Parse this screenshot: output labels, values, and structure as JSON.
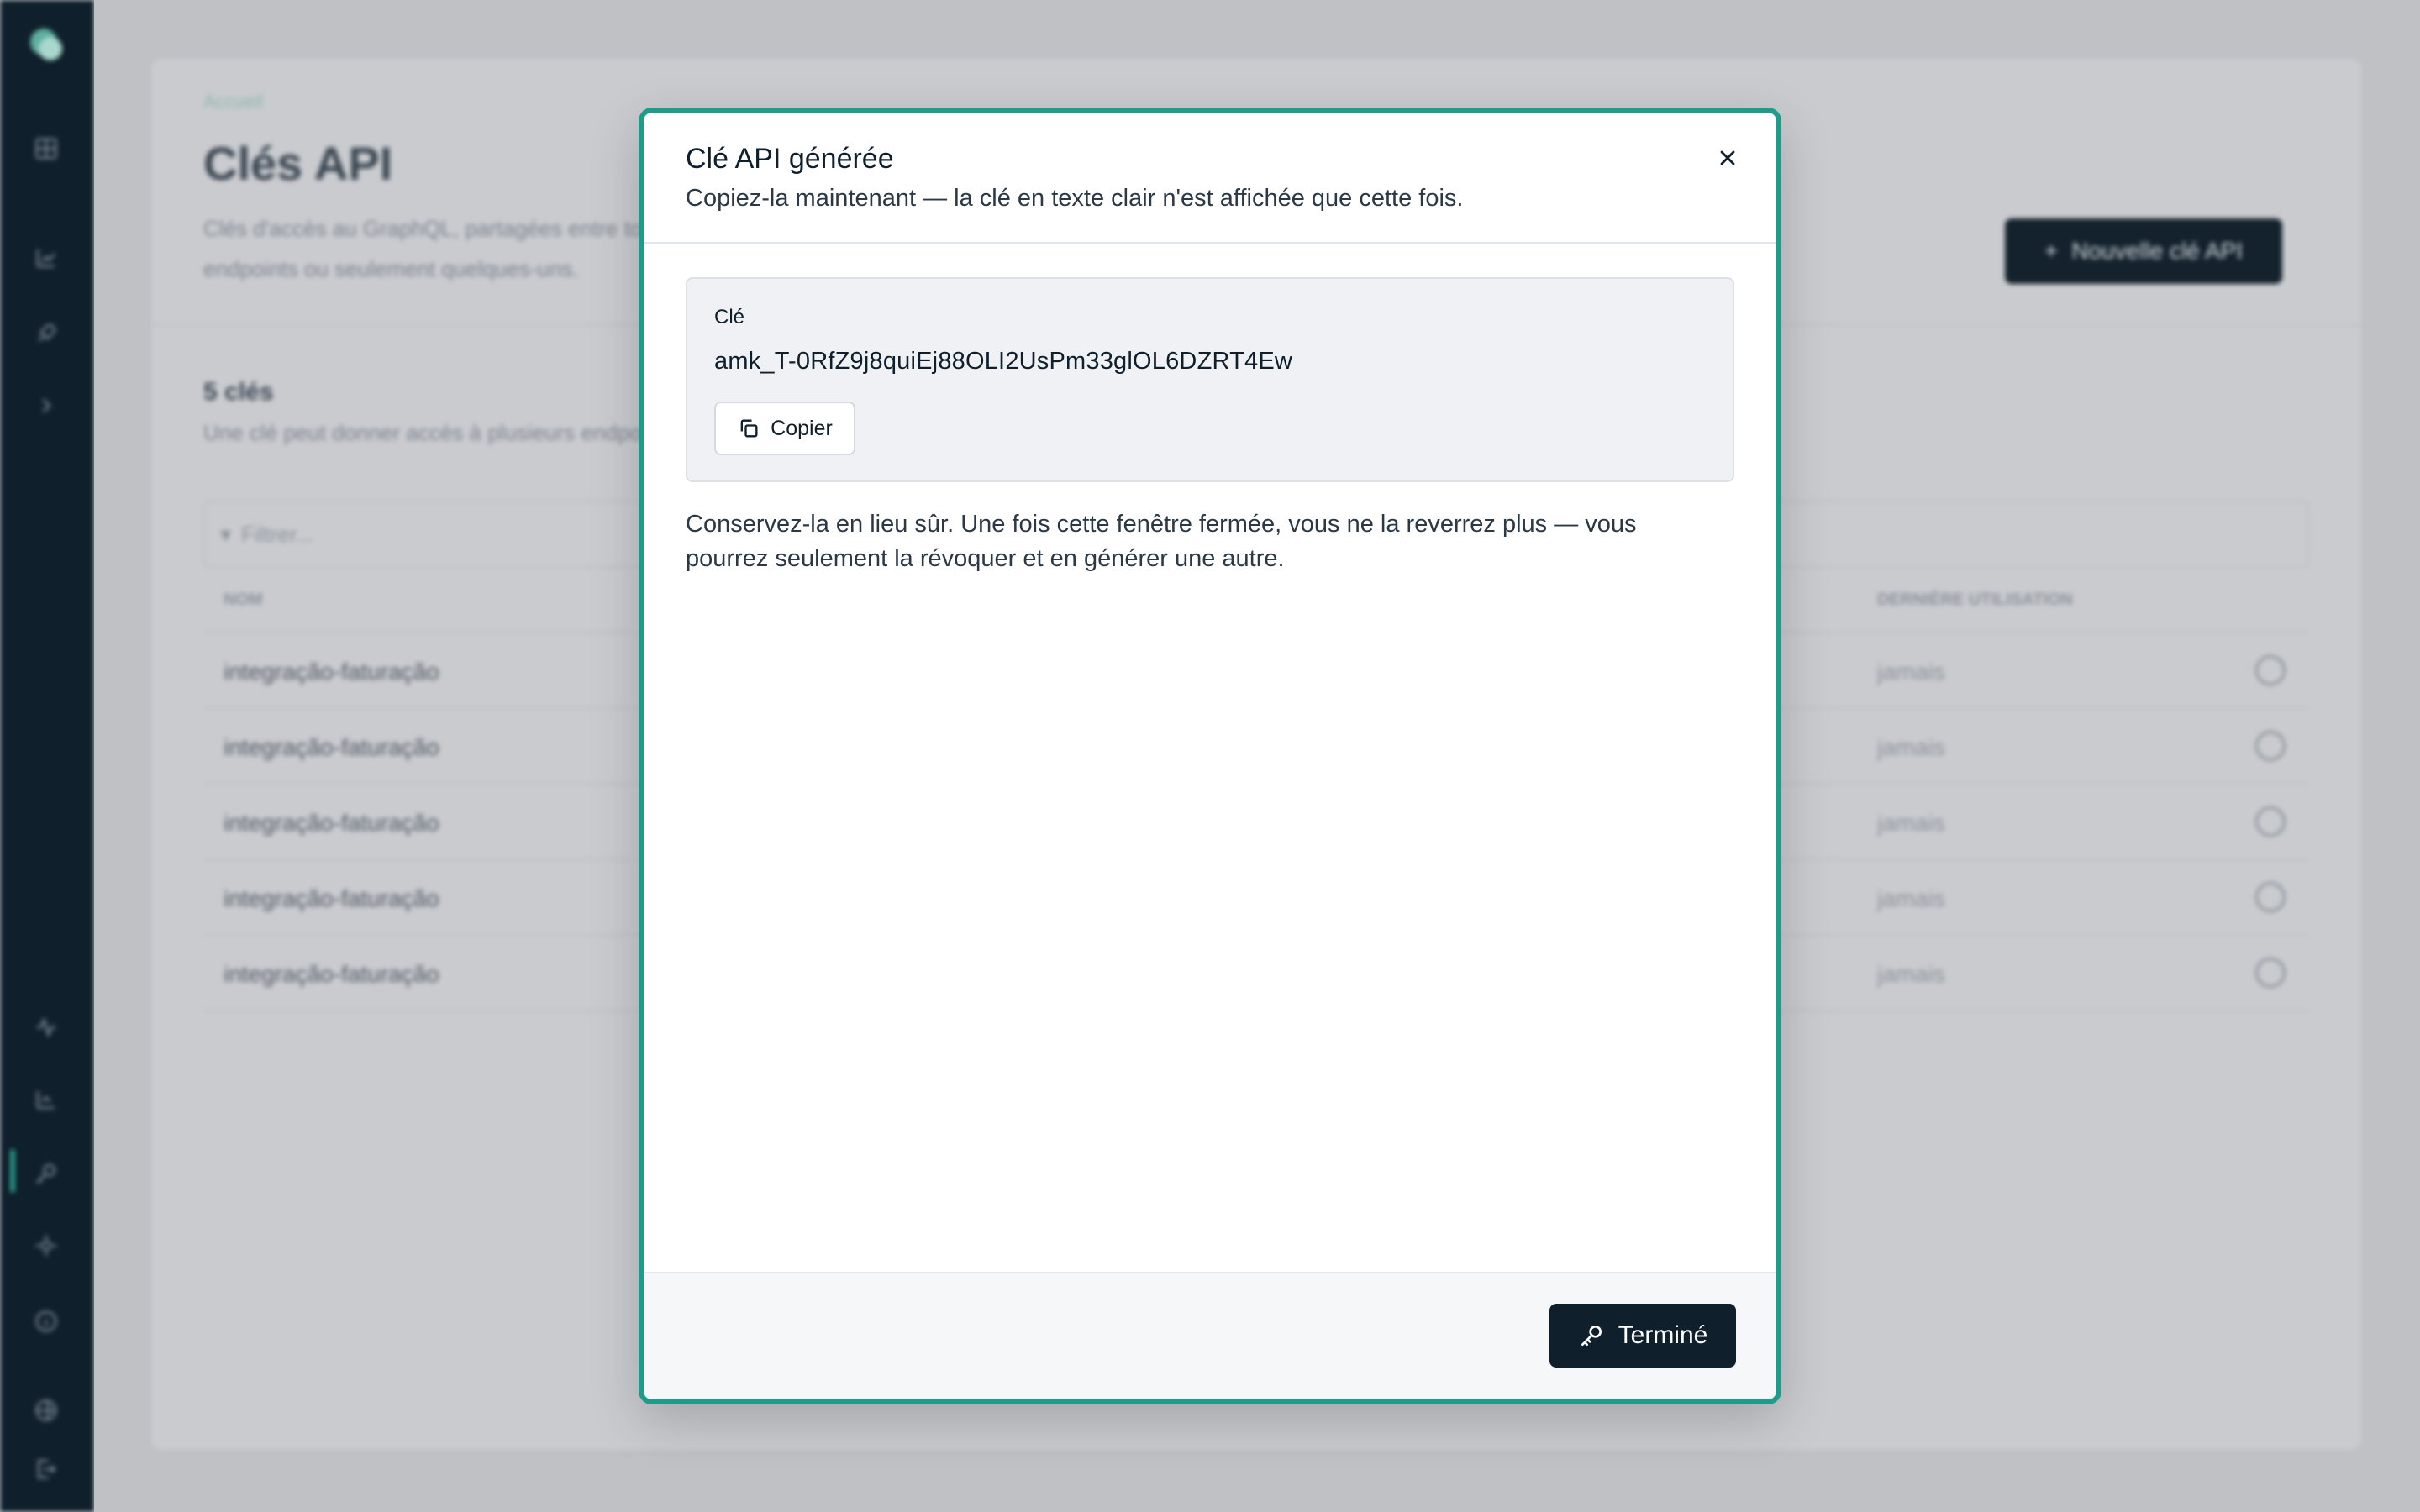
{
  "background": {
    "breadcrumb": "Accueil",
    "page_title": "Clés API",
    "page_description": "Clés d'accès au GraphQL, partagées entre tous les endpoints ou seulement quelques-uns.",
    "new_key_button": "Nouvelle clé API",
    "count_title": "5 clés",
    "count_subtitle": "Une clé peut donner accès à plusieurs endpoints.",
    "filter_placeholder": "Filtrer...",
    "columns": {
      "name": "NOM",
      "last_used": "DERNIÈRE UTILISATION"
    },
    "rows": [
      {
        "name": "integração-faturação",
        "last_used": "jamais"
      },
      {
        "name": "integração-faturação",
        "last_used": "jamais"
      },
      {
        "name": "integração-faturação",
        "last_used": "jamais"
      },
      {
        "name": "integração-faturação",
        "last_used": "jamais"
      },
      {
        "name": "integração-faturação",
        "last_used": "jamais"
      }
    ]
  },
  "sidebar": {
    "icons": [
      "logo-icon",
      "grid-icon",
      "chart-icon",
      "rocket-icon",
      "chevron-icon",
      "activity-icon",
      "analytics-icon",
      "key-icon",
      "settings-icon",
      "info-icon",
      "globe-icon",
      "logout-icon"
    ],
    "active_item": "key-icon"
  },
  "modal": {
    "title": "Clé API générée",
    "subtitle": "Copiez-la maintenant — la clé en texte clair n'est affichée que cette fois.",
    "key_label": "Clé",
    "key_value": "amk_T-0RfZ9j8quiEj88OLI2UsPm33glOL6DZRT4Ew",
    "copy_button": "Copier",
    "note": "Conservez-la en lieu sûr. Une fois cette fenêtre fermée, vous ne la reverrez plus — vous pourrez seulement la révoquer et en générer une autre.",
    "done_button": "Terminé"
  },
  "colors": {
    "accent": "#1e9b8b",
    "dark": "#0f1f2b",
    "overlay": "#bfc1c5"
  }
}
